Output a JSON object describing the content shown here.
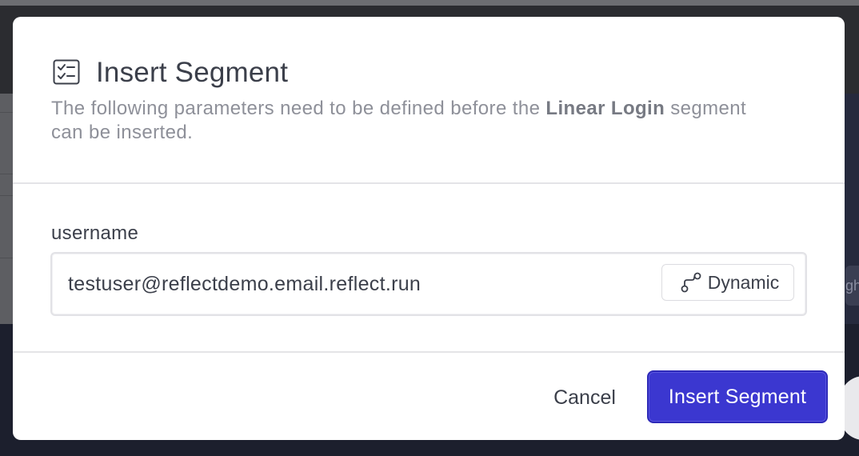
{
  "background": {
    "partial_text": "gh"
  },
  "dialog": {
    "icon": "checklist-icon",
    "title": "Insert Segment",
    "description": {
      "before": "The following parameters need to be defined before the ",
      "segment_name": "Linear Login",
      "after": " segment can be inserted."
    },
    "fields": [
      {
        "label": "username",
        "value": "testuser@reflectdemo.email.reflect.run",
        "mode_button": {
          "icon": "dynamic-flow-icon",
          "label": "Dynamic"
        }
      }
    ],
    "footer": {
      "cancel_label": "Cancel",
      "submit_label": "Insert Segment"
    }
  },
  "colors": {
    "primary": "#3b37d0",
    "title_text": "#3b3f4a",
    "muted_text": "#8e9099"
  }
}
